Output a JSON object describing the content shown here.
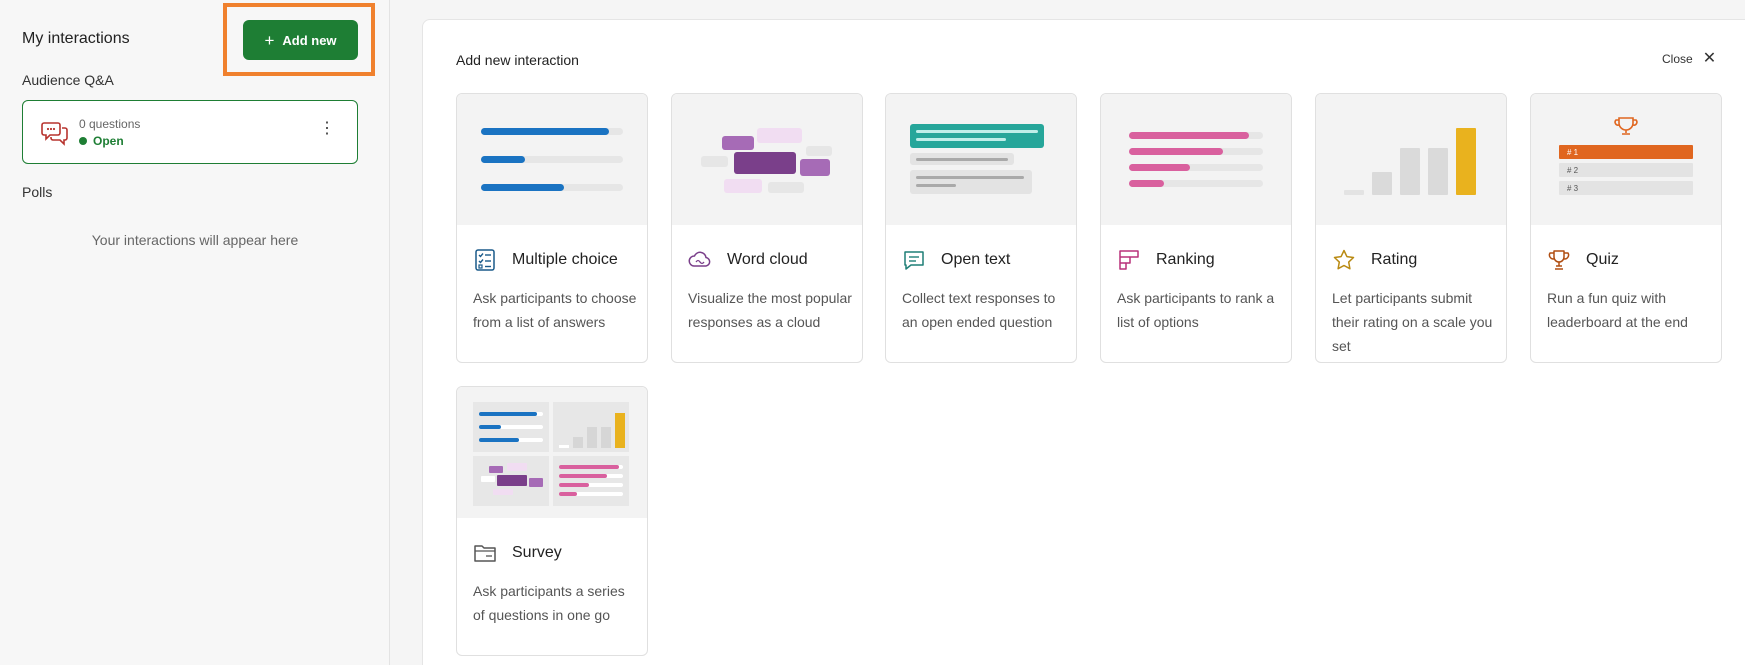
{
  "sidebar": {
    "title": "My interactions",
    "add_button_label": "Add new",
    "sections": {
      "qa": "Audience Q&A",
      "polls": "Polls"
    },
    "qa_card": {
      "count": "0 questions",
      "status": "Open"
    },
    "empty_text": "Your interactions will appear here"
  },
  "panel": {
    "title": "Add new interaction",
    "close_label": "Close",
    "cards": [
      {
        "name": "Multiple choice",
        "desc": "Ask participants to choose from a list of answers",
        "icon": "checklist-icon"
      },
      {
        "name": "Word cloud",
        "desc": "Visualize the most popular responses as a cloud",
        "icon": "cloud-icon"
      },
      {
        "name": "Open text",
        "desc": "Collect text responses to an open ended question",
        "icon": "chat-icon"
      },
      {
        "name": "Ranking",
        "desc": "Ask participants to rank a list of options",
        "icon": "ranking-icon"
      },
      {
        "name": "Rating",
        "desc": "Let participants submit their rating on a scale you set",
        "icon": "star-icon"
      },
      {
        "name": "Quiz",
        "desc": "Run a fun quiz with leaderboard at the end",
        "icon": "trophy-icon"
      },
      {
        "name": "Survey",
        "desc": "Ask participants a series of questions in one go",
        "icon": "folder-icon"
      }
    ],
    "quiz_ranks": [
      "# 1",
      "# 2",
      "# 3"
    ]
  },
  "colors": {
    "brand_green": "#1e7e34",
    "highlight_orange": "#f0812e",
    "blue": "#1a73c2",
    "purple": "#7a3f8a",
    "teal": "#26a69a",
    "pink": "#d9609e",
    "gold": "#e9b21e",
    "quiz_orange": "#e0661f"
  }
}
